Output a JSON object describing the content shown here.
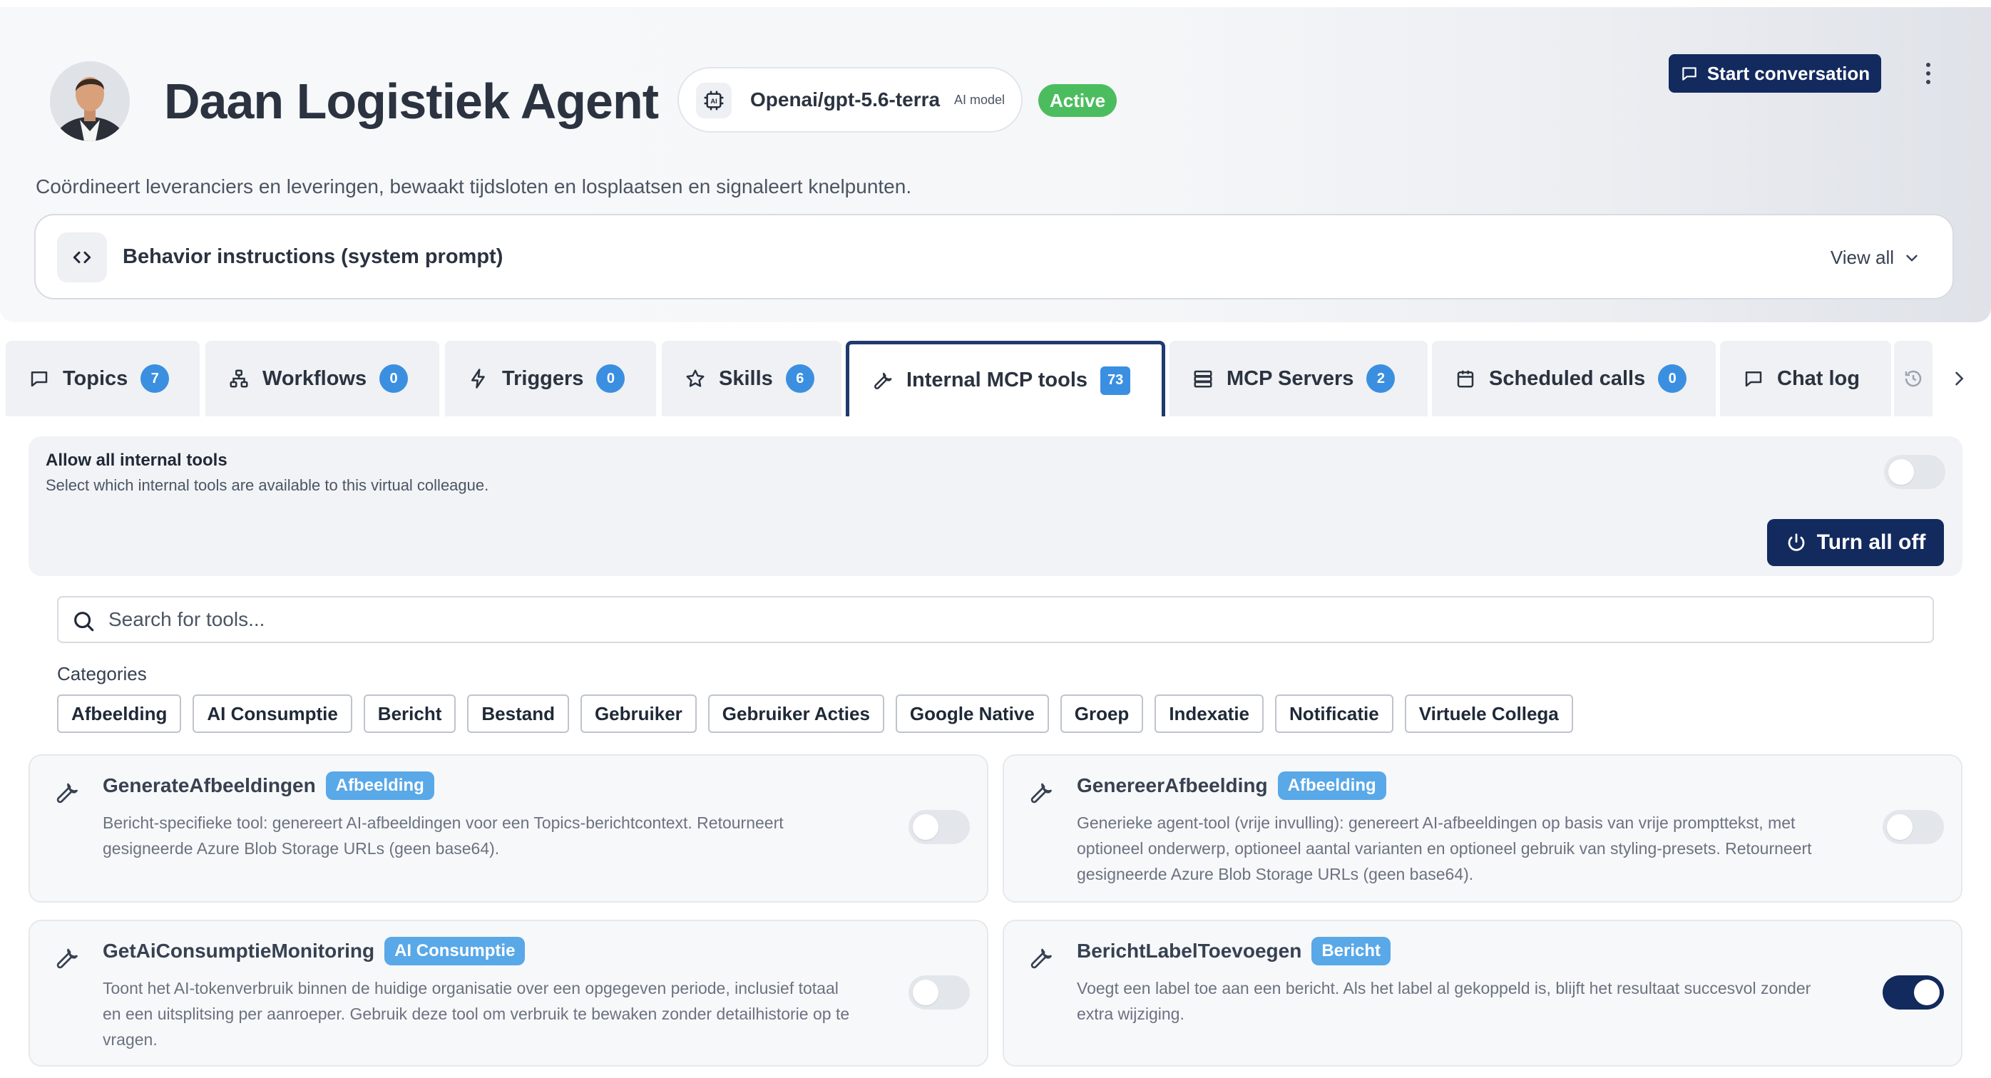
{
  "agent": {
    "name": "Daan Logistiek Agent",
    "model": "Openai/gpt-5.6-terra",
    "model_tag": "AI model",
    "status": "Active",
    "description": "Coördineert leveranciers en leveringen, bewaakt tijdsloten en losplaatsen en signaleert knelpunten."
  },
  "header": {
    "start_conversation": "Start conversation",
    "behavior_title": "Behavior instructions (system prompt)",
    "view_all": "View all"
  },
  "tabs": [
    {
      "label": "Topics",
      "count": "7",
      "icon": "chat-icon"
    },
    {
      "label": "Workflows",
      "count": "0",
      "icon": "workflow-icon"
    },
    {
      "label": "Triggers",
      "count": "0",
      "icon": "bolt-icon"
    },
    {
      "label": "Skills",
      "count": "6",
      "icon": "star-icon"
    },
    {
      "label": "Internal MCP tools",
      "count": "73",
      "icon": "wrench-icon",
      "active": true
    },
    {
      "label": "MCP Servers",
      "count": "2",
      "icon": "server-icon"
    },
    {
      "label": "Scheduled calls",
      "count": "0",
      "icon": "calendar-icon"
    },
    {
      "label": "Chat log",
      "icon": "chat-icon"
    }
  ],
  "tools_panel": {
    "allow_title": "Allow all internal tools",
    "allow_subtitle": "Select which internal tools are available to this virtual colleague.",
    "allow_all_enabled": false,
    "turn_all_off": "Turn all off",
    "search_placeholder": "Search for tools...",
    "categories_label": "Categories",
    "categories": [
      "Afbeelding",
      "AI Consumptie",
      "Bericht",
      "Bestand",
      "Gebruiker",
      "Gebruiker Acties",
      "Google Native",
      "Groep",
      "Indexatie",
      "Notificatie",
      "Virtuele Collega"
    ]
  },
  "tools": [
    {
      "name": "GenerateAfbeeldingen",
      "category": "Afbeelding",
      "description": "Bericht-specifieke tool: genereert AI-afbeeldingen voor een Topics-berichtcontext. Retourneert gesigneerde Azure Blob Storage URLs (geen base64).",
      "enabled": false
    },
    {
      "name": "GenereerAfbeelding",
      "category": "Afbeelding",
      "description": "Generieke agent-tool (vrije invulling): genereert AI-afbeeldingen op basis van vrije prompttekst, met optioneel onderwerp, optioneel aantal varianten en optioneel gebruik van styling-presets. Retourneert gesigneerde Azure Blob Storage URLs (geen base64).",
      "enabled": false
    },
    {
      "name": "GetAiConsumptieMonitoring",
      "category": "AI Consumptie",
      "description": "Toont het AI-tokenverbruik binnen de huidige organisatie over een opgegeven periode, inclusief totaal en een uitsplitsing per aanroeper. Gebruik deze tool om verbruik te bewaken zonder detailhistorie op te vragen.",
      "enabled": false
    },
    {
      "name": "BerichtLabelToevoegen",
      "category": "Bericht",
      "description": "Voegt een label toe aan een bericht. Als het label al gekoppeld is, blijft het resultaat succesvol zonder extra wijziging.",
      "enabled": true
    }
  ]
}
